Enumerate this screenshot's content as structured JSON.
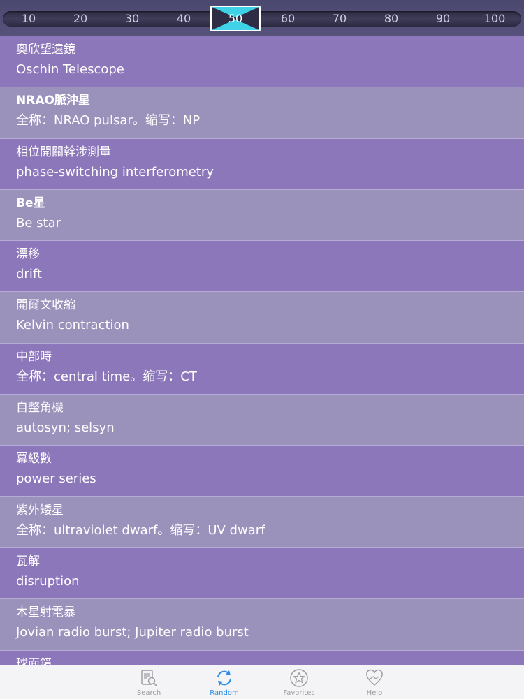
{
  "ruler": {
    "ticks": [
      "10",
      "20",
      "30",
      "40",
      "50",
      "60",
      "70",
      "80",
      "90",
      "100"
    ],
    "selected": "50"
  },
  "entries": [
    {
      "zh": "奧欣望遠鏡",
      "en": "Oschin Telescope",
      "bold": false
    },
    {
      "zh": "NRAO脈沖星",
      "en": "全称：NRAO pulsar。缩写：NP",
      "bold": true
    },
    {
      "zh": "相位開關幹涉測量",
      "en": "phase-switching interferometry",
      "bold": false
    },
    {
      "zh": "Be星",
      "en": "Be star",
      "bold": true
    },
    {
      "zh": "漂移",
      "en": "drift",
      "bold": false
    },
    {
      "zh": "開爾文收縮",
      "en": "Kelvin contraction",
      "bold": false
    },
    {
      "zh": "中部時",
      "en": "全称：central time。缩写：CT",
      "bold": false
    },
    {
      "zh": "自整角機",
      "en": "autosyn; selsyn",
      "bold": false
    },
    {
      "zh": "冪級數",
      "en": "power series",
      "bold": false
    },
    {
      "zh": "紫外矮星",
      "en": "全称：ultraviolet dwarf。缩写：UV dwarf",
      "bold": false
    },
    {
      "zh": "瓦解",
      "en": "disruption",
      "bold": false
    },
    {
      "zh": "木星射電暴",
      "en": "Jovian radio burst; Jupiter radio burst",
      "bold": false
    },
    {
      "zh": "球面鏡",
      "en": "",
      "bold": false
    }
  ],
  "tabs": {
    "search": "Search",
    "random": "Random",
    "favorites": "Favorites",
    "help": "Help"
  },
  "colors": {
    "accent": "#2f8de6",
    "row_a": "#8d77bb",
    "row_b": "#9b92bc",
    "selector": "#3fd2e6"
  }
}
